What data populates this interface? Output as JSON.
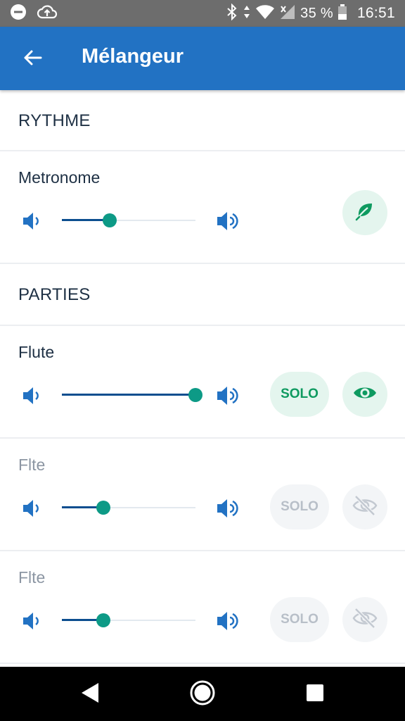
{
  "status_bar": {
    "battery_percent": "35 %",
    "time": "16:51",
    "icons": [
      "do-not-disturb-icon",
      "cloud-upload-icon",
      "bluetooth-icon",
      "data-arrows-icon",
      "wifi-icon",
      "signal-icon",
      "battery-icon"
    ]
  },
  "app_bar": {
    "title": "Mélangeur",
    "background": "#2272c3"
  },
  "sections": {
    "rhythm_header": "RYTHME",
    "parts_header": "PARTIES"
  },
  "tracks": [
    {
      "name": "Metronome",
      "volume": 0.36,
      "muted": false,
      "has_solo": false,
      "toggle_icon": "leaf-icon"
    },
    {
      "name": "Flute",
      "volume": 1.0,
      "muted": false,
      "has_solo": true,
      "solo_label": "SOLO",
      "toggle_icon": "eye-icon"
    },
    {
      "name": "Flte",
      "volume": 0.31,
      "muted": true,
      "has_solo": true,
      "solo_label": "SOLO",
      "toggle_icon": "eye-off-icon"
    },
    {
      "name": "Flte",
      "volume": 0.31,
      "muted": true,
      "has_solo": true,
      "solo_label": "SOLO",
      "toggle_icon": "eye-off-icon"
    }
  ],
  "colors": {
    "accent_green": "#0e9a60",
    "slider_thumb": "#0d9a86",
    "slider_fill": "#0c4e8f",
    "speaker_blue": "#2272c3"
  },
  "nav_bar": {
    "icons": [
      "back-triangle-icon",
      "home-circle-icon",
      "recents-square-icon"
    ]
  }
}
